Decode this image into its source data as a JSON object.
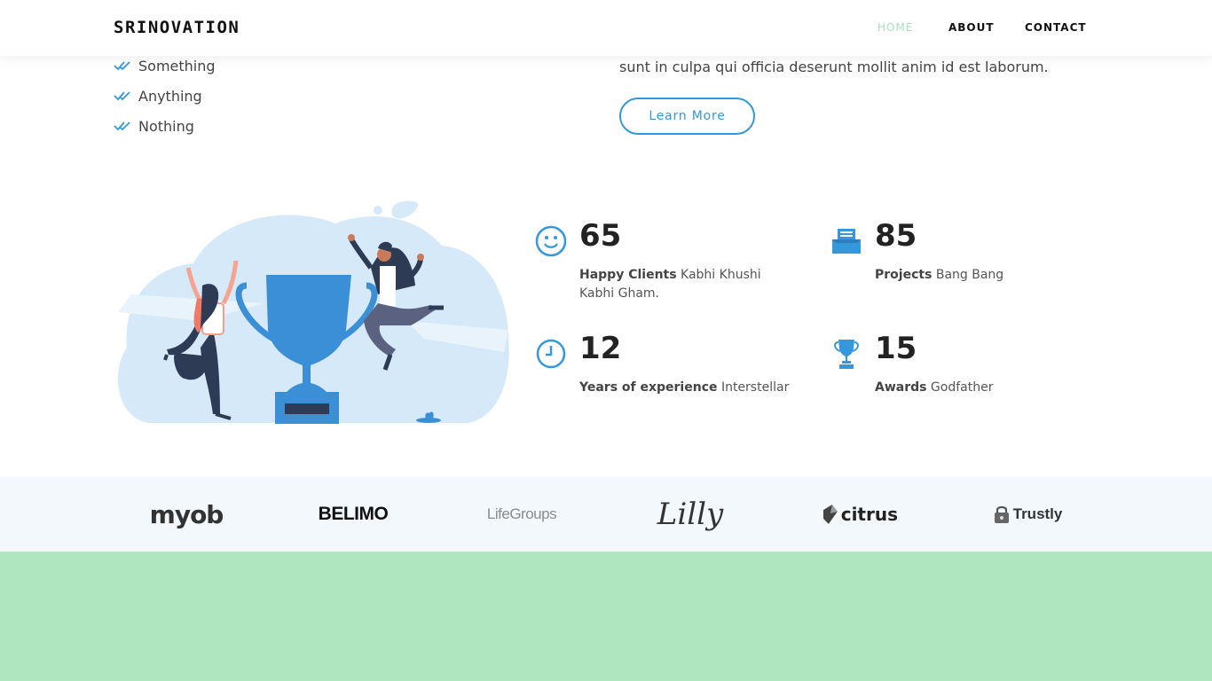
{
  "header": {
    "logo": "SRINOVATION",
    "nav": [
      "HOME",
      "ABOUT",
      "CONTACT"
    ]
  },
  "about": {
    "checklist": [
      "Something",
      "Anything",
      "Nothing"
    ],
    "paragraph": "sunt in culpa qui officia deserunt mollit anim id est laborum.",
    "button_label": "Learn More"
  },
  "counts": [
    {
      "icon": "smiley-icon",
      "value": "65",
      "label": "Happy Clients",
      "text": " Kabhi Khushi Kabhi Gham."
    },
    {
      "icon": "document-tray-icon",
      "value": "85",
      "label": "Projects",
      "text": " Bang Bang"
    },
    {
      "icon": "clock-icon",
      "value": "12",
      "label": "Years of experience",
      "text": " Interstellar"
    },
    {
      "icon": "trophy-icon",
      "value": "15",
      "label": "Awards",
      "text": " Godfather"
    }
  ],
  "clients": [
    "myob",
    "BELIMO",
    "LifeGroups",
    "Lilly",
    "citrus",
    "Trustly"
  ],
  "colors": {
    "accent": "#3498db",
    "nav_active": "#a7e0bd",
    "footer_band": "#afe6c0",
    "clients_bg": "#f3f8fc"
  }
}
